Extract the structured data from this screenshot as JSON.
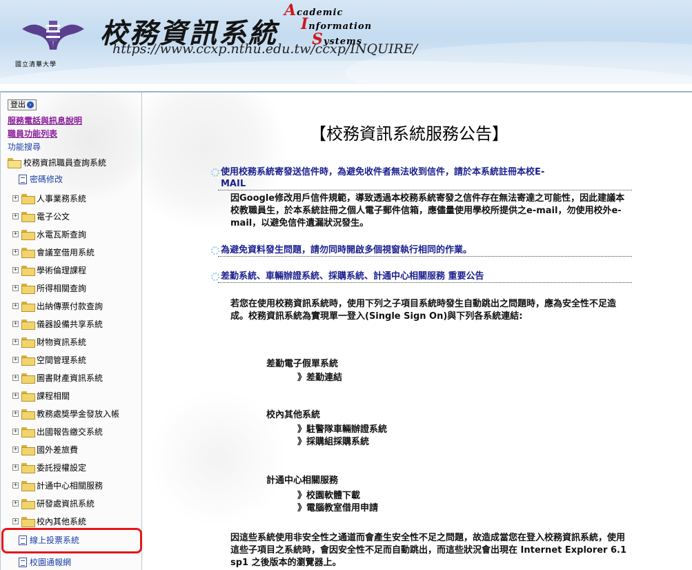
{
  "header": {
    "title": "校務資訊系統",
    "english": {
      "line1_cap": "A",
      "line1_rest": "cademic",
      "line2_cap": "I",
      "line2_rest": "nformation",
      "line3_cap": "S",
      "line3_rest": "ystems"
    },
    "url": "https://www.ccxp.nthu.edu.tw/ccxp/INQUIRE/",
    "school": "國立清華大學"
  },
  "sidebar": {
    "logout": "登出",
    "links": [
      "服務電話與訊息說明",
      "職員功能列表"
    ],
    "search": "功能搜尋",
    "root": "校務資訊職員查詢系統",
    "password": "密碼修改",
    "items": [
      "人事業務系統",
      "電子公文",
      "水電瓦斯查詢",
      "會議室借用系統",
      "學術倫理課程",
      "所得相關查詢",
      "出納傳票付款查詢",
      "儀器設備共享系統",
      "財物資訊系統",
      "空間管理系統",
      "圖書財產資訊系統",
      "課程相關",
      "教務處獎學金發放入帳",
      "出國報告繳交系統",
      "國外差旅費",
      "委託授權設定",
      "計通中心相關服務",
      "研發處資訊系統",
      "校內其他系統"
    ],
    "leaves": [
      "線上投票系統",
      "校園通報網"
    ]
  },
  "main": {
    "title": "【校務資訊系統服務公告】",
    "section1_title_line1": "使用校務系統寄發送信件時，為避免收件者無法收到信件，請於本系統註冊本校E-",
    "section1_title_line2": "MAIL",
    "section1_body": "因Google修改用戶信件規範，導致透過本校務系統寄發之信件存在無法寄達之可能性，因此建議本校教職員生，於本系統註冊之個人電子郵件信箱，應儘量使用學校所提供之e-mail，勿使用校外e-mail，以避免信件遺漏狀況發生。",
    "section2_title": "為避免資料發生問題，請勿同時開啟多個視窗執行相同的作業。",
    "section3_title": "差勤系統、車輛辦證系統、採購系統、計通中心相關服務 重要公告",
    "section3_body": "若您在使用校務資訊系統時，使用下列之子項目系統時發生自動跳出之問題時，應為安全性不足造成。校務資訊系統為實現單一登入(Single Sign On)與下列各系統連結:",
    "groups": [
      {
        "heading": "差勤電子假單系統",
        "links": [
          "》差勤連結"
        ]
      },
      {
        "heading": "校內其他系統",
        "links": [
          "》駐警隊車輛辦證系統",
          "》採購組採購系統"
        ]
      },
      {
        "heading": "計通中心相關服務",
        "links": [
          "》校園軟體下載",
          "》電腦教室借用申請"
        ]
      }
    ],
    "footer_body": "因這些系統使用非安全性之通道而會產生安全性不足之問題，故造成當您在登入校務資訊系統，使用這些子項目之系統時，會因安全性不足而自動跳出，而這些狀況會出現在 Internet Explorer 6.1 sp1 之後版本的瀏覽器上。"
  },
  "colors": {
    "highlight": "#e8141b",
    "link_purple": "#8b1f9b",
    "section_blue": "#1a1f8f"
  }
}
